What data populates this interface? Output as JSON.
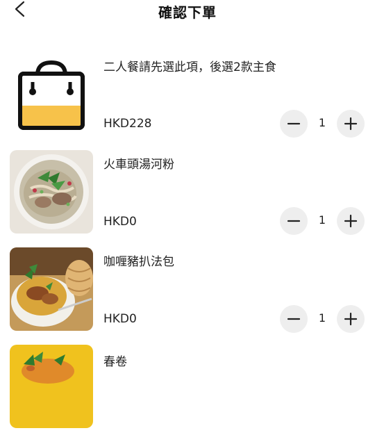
{
  "header": {
    "title": "確認下單",
    "back_icon": "chevron-left-icon"
  },
  "items": [
    {
      "name": "二人餐請先選此項，後選2款主食",
      "price": "HKD228",
      "quantity": "1",
      "image": "shopping-bag-icon"
    },
    {
      "name": "火車頭湯河粉",
      "price": "HKD0",
      "quantity": "1",
      "image": "beef-pho-noodle-soup-photo"
    },
    {
      "name": "咖喱豬扒法包",
      "price": "HKD0",
      "quantity": "1",
      "image": "curry-pork-chop-baguette-photo"
    },
    {
      "name": "春卷",
      "image": "spring-rolls-photo"
    }
  ],
  "stepper": {
    "minus_icon": "minus-icon",
    "plus_icon": "plus-icon"
  },
  "colors": {
    "bag_yellow": "#f7c24a",
    "bag_outline": "#111111",
    "stepper_bg": "#eeeeee",
    "text": "#222222"
  }
}
